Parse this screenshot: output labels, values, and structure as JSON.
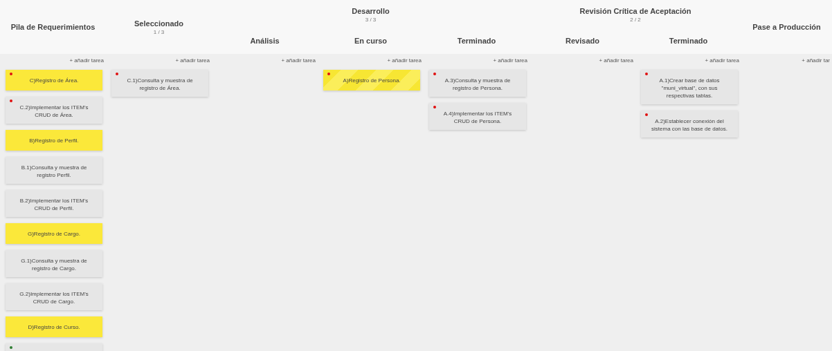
{
  "stages": [
    {
      "title": "Pila de Requerimientos",
      "columns": [
        {
          "add": "+ añadir tarea",
          "cards": [
            {
              "kind": "feature",
              "color": "#e01010",
              "text": "C)Registro de Área."
            },
            {
              "kind": "task",
              "color": "#e01010",
              "text": "C.2)Implementar los ITEM's CRUD de Área."
            },
            {
              "kind": "feature",
              "text": "B)Registro de Perfil."
            },
            {
              "kind": "task",
              "text": "B.1)Consulta y muestra de registro Perfil."
            },
            {
              "kind": "task",
              "text": "B.2)Implementar los ITEM's CRUD de Perfil."
            },
            {
              "kind": "feature",
              "text": "G)Registro de Cargo."
            },
            {
              "kind": "task",
              "text": "G.1)Consulta y muestra de registro de Cargo."
            },
            {
              "kind": "task",
              "text": "G.2)Implementar los ITEM's CRUD de Cargo."
            },
            {
              "kind": "feature",
              "text": "D)Registro de Curso."
            },
            {
              "kind": "task",
              "color": "#2e7d32"
            }
          ]
        }
      ]
    },
    {
      "title": "Seleccionado",
      "count": "1 / 3",
      "columns": [
        {
          "add": "+ añadir tarea",
          "cards": [
            {
              "kind": "task",
              "color": "#e01010",
              "text": "C.1)Consulta y muestra de registro de Área."
            }
          ]
        }
      ]
    },
    {
      "title": "Desarrollo",
      "count": "3 / 3",
      "columns": [
        {
          "title": "Análisis",
          "add": "+ añadir tarea"
        },
        {
          "title": "En curso",
          "add": "+ añadir tarea",
          "cards": [
            {
              "kind": "feature",
              "striped": true,
              "color": "#e01010",
              "text": "A)Registro de Persona."
            }
          ]
        },
        {
          "title": "Terminado",
          "add": "+ añadir tarea",
          "cards": [
            {
              "kind": "task",
              "color": "#e01010",
              "text": "A.3)Consulta y muestra de registro de Persona."
            },
            {
              "kind": "task",
              "color": "#e01010",
              "text": "A.4)Implementar los ITEM's CRUD de Persona."
            }
          ]
        }
      ]
    },
    {
      "title": "Revisión Crítica de Aceptación",
      "count": "2 / 2",
      "columns": [
        {
          "title": "Revisado",
          "add": "+ añadir tarea"
        },
        {
          "title": "Terminado",
          "add": "+ añadir tarea",
          "cards": [
            {
              "kind": "task",
              "color": "#e01010",
              "text": "A.1)Crear base de datos \"muni_virtual\", con sus respectivas tablas."
            },
            {
              "kind": "task",
              "color": "#e01010",
              "text": "A.2)Establecer conexión del sistema con las base de datos."
            }
          ]
        }
      ]
    },
    {
      "title": "Pase a Producción",
      "columns": [
        {
          "add": "+ añadir tar"
        }
      ]
    }
  ]
}
